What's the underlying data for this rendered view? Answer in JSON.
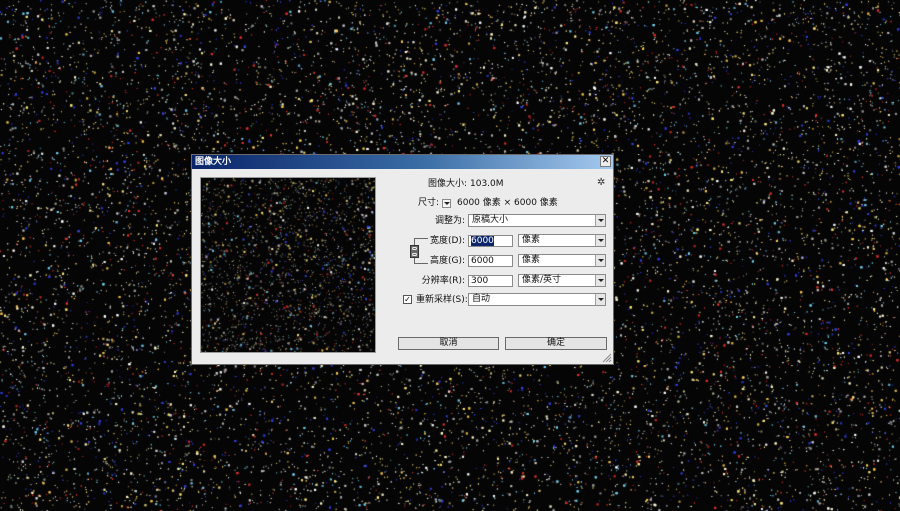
{
  "dialog": {
    "title": "图像大小",
    "close_glyph": "✕",
    "image_size_label": "图像大小:",
    "image_size_value": "103.0M",
    "dimensions_label": "尺寸:",
    "dimensions_value": "6000 像素 × 6000 像素",
    "resize_label": "调整为:",
    "resize_value": "原稿大小",
    "width_label": "宽度(D):",
    "width_value": "6000",
    "width_unit": "像素",
    "height_label": "高度(G):",
    "height_value": "6000",
    "height_unit": "像素",
    "resolution_label": "分辨率(R):",
    "resolution_value": "300",
    "resolution_unit": "像素/英寸",
    "resample_label": "重新采样(S):",
    "resample_checked": "✓",
    "resample_value": "自动",
    "cancel_label": "取消",
    "ok_label": "确定",
    "gear_glyph": "✲"
  },
  "colors": {
    "title_bar_start": "#0a246a",
    "title_bar_end": "#a6caf0",
    "dialog_background": "#ececec",
    "background": "#050505"
  },
  "icons": [
    "close-icon",
    "gear-icon",
    "dropdown-arrow-icon",
    "link-chain-icon",
    "checkmark-icon",
    "resize-grip-icon"
  ]
}
